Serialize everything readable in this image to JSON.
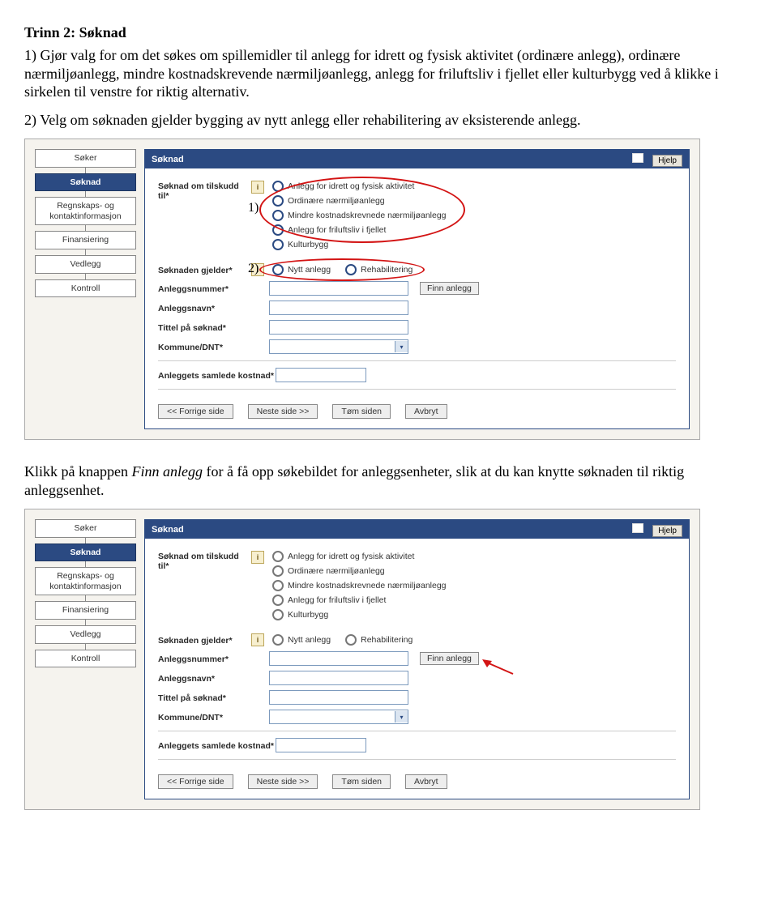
{
  "heading": "Trinn 2: Søknad",
  "para1_num": "1)",
  "para1": "Gjør valg for om det søkes om spillemidler til anlegg for idrett og fysisk aktivitet (ordinære anlegg), ordinære nærmiljøanlegg, mindre kostnadskrevende nærmiljøanlegg, anlegg for friluftsliv i fjellet eller kulturbygg ved å klikke i sirkelen til venstre for riktig alternativ.",
  "para2_num": "2)",
  "para2": "Velg om søknaden gjelder bygging av nytt anlegg eller rehabilitering av eksisterende anlegg.",
  "para3a": "Klikk på knappen ",
  "para3b": "Finn anlegg",
  "para3c": " for å få opp søkebildet for anleggsenheter, slik at du kan knytte søknaden til riktig anleggsenhet.",
  "nav": {
    "soker": "Søker",
    "soknad": "Søknad",
    "regnskap": "Regnskaps- og kontaktinformasjon",
    "finansiering": "Finansiering",
    "vedlegg": "Vedlegg",
    "kontroll": "Kontroll"
  },
  "panel": {
    "title": "Søknad",
    "help": "Hjelp"
  },
  "form": {
    "soknad_om": "Søknad om tilskudd til*",
    "opt1": "Anlegg for idrett og fysisk aktivitet",
    "opt2": "Ordinære nærmiljøanlegg",
    "opt3": "Mindre kostnadskrevnede nærmiljøanlegg",
    "opt4": "Anlegg for friluftsliv i fjellet",
    "opt5": "Kulturbygg",
    "soknaden_gjelder": "Søknaden gjelder*",
    "nytt": "Nytt anlegg",
    "rehab": "Rehabilitering",
    "anleggsnummer": "Anleggsnummer*",
    "finn": "Finn anlegg",
    "anleggsnavn": "Anleggsnavn*",
    "tittel": "Tittel på søknad*",
    "kommune": "Kommune/DNT*",
    "samlet": "Anleggets samlede kostnad*"
  },
  "footer": {
    "back": "<< Forrige side",
    "next": "Neste side >>",
    "clear": "Tøm siden",
    "cancel": "Avbryt"
  },
  "markers": {
    "m1": "1)",
    "m2": "2)"
  }
}
